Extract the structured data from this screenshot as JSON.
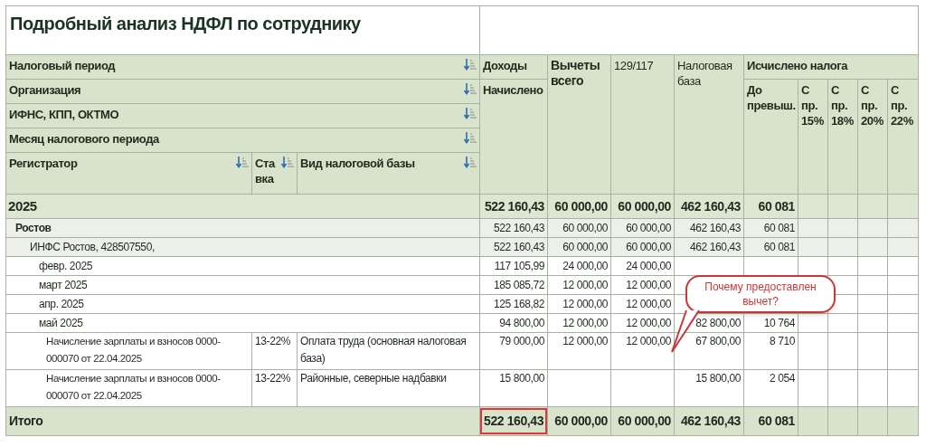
{
  "title": "Подробный анализ НДФЛ по сотруднику",
  "header": {
    "filter_rows": [
      "Налоговый период",
      "Организация",
      "ИФНС, КПП, ОКТМО",
      "Месяц налогового периода"
    ],
    "registrar": "Регистратор",
    "rate": "Ста вка",
    "base_kind": "Вид налоговой базы",
    "income_group": "Доходы",
    "income_accrued": "Начислено",
    "deductions": "Вычеты всего",
    "code": "129/117",
    "tax_base": "Налоговая база",
    "computed_group": "Исчислено налога",
    "computed_columns": [
      "До превыш.",
      "С пр. 15%",
      "С пр. 18%",
      "С пр. 20%",
      "С пр. 22%"
    ]
  },
  "rows": [
    {
      "kind": "year",
      "label": "2025",
      "values": {
        "income": "522 160,43",
        "deductions": "60 000,00",
        "code": "60 000,00",
        "tax_base": "462 160,43",
        "tax": "60 081"
      },
      "children": [
        {
          "kind": "organization",
          "label": "Ростов",
          "values": {
            "income": "522 160,43",
            "deductions": "60 000,00",
            "code": "60 000,00",
            "tax_base": "462 160,43",
            "tax": "60 081"
          },
          "children": [
            {
              "kind": "inspection",
              "label": "ИНФС Ростов, 428507550,",
              "values": {
                "income": "522 160,43",
                "deductions": "60 000,00",
                "code": "60 000,00",
                "tax_base": "462 160,43",
                "tax": "60 081"
              },
              "children": [
                {
                  "kind": "month",
                  "label": "февр. 2025",
                  "values": {
                    "income": "117 105,99",
                    "deductions": "24 000,00",
                    "code": "24 000,00"
                  }
                },
                {
                  "kind": "month",
                  "label": "март 2025",
                  "values": {
                    "income": "185 085,72",
                    "deductions": "12 000,00",
                    "code": "12 000,00"
                  }
                },
                {
                  "kind": "month",
                  "label": "апр. 2025",
                  "values": {
                    "income": "125 168,82",
                    "deductions": "12 000,00",
                    "code": "12 000,00"
                  }
                },
                {
                  "kind": "month",
                  "label": "май 2025",
                  "values": {
                    "income": "94 800,00",
                    "deductions": "12 000,00",
                    "code": "12 000,00",
                    "tax_base": "82 800,00",
                    "tax": "10 764"
                  },
                  "children": [
                    {
                      "kind": "document",
                      "label": "Начисление зарплаты и взносов 0000-000070 от 22.04.2025",
                      "rate": "13-22%",
                      "base_kind": "Оплата труда (основная налоговая база)",
                      "values": {
                        "income": "79 000,00",
                        "deductions": "12 000,00",
                        "code": "12 000,00",
                        "tax_base": "67 800,00",
                        "tax": "8 710"
                      }
                    },
                    {
                      "kind": "document",
                      "label": "Начисление зарплаты и взносов 0000-000070 от 22.04.2025",
                      "rate": "13-22%",
                      "base_kind": "Районные, северные надбавки",
                      "values": {
                        "income": "15 800,00",
                        "tax_base": "15 800,00",
                        "tax": "2 054"
                      }
                    }
                  ]
                }
              ]
            }
          ]
        }
      ]
    }
  ],
  "total": {
    "label": "Итого",
    "cells": [
      {
        "value": "522 160,43",
        "highlighted": true
      },
      {
        "value": "60 000,00",
        "highlighted": false
      },
      {
        "value": "60 000,00",
        "highlighted": false
      },
      {
        "value": "462 160,43",
        "highlighted": false
      },
      {
        "value": "60 081",
        "highlighted": false
      }
    ]
  },
  "callout": {
    "text": "Почему предоставлен вычет?"
  }
}
